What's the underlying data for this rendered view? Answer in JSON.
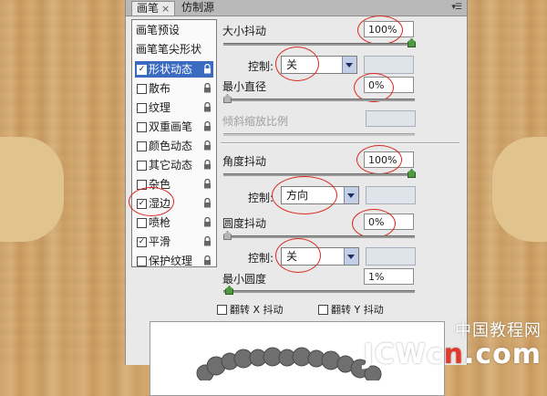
{
  "tabs": [
    {
      "label": "画笔",
      "close": "×"
    },
    {
      "label": "仿制源"
    }
  ],
  "panel_menu_icon": "panel-menu-icon",
  "sidebar": {
    "header_items": [
      "画笔预设",
      "画笔笔尖形状"
    ],
    "items": [
      {
        "label": "形状动态",
        "checked": true,
        "selected": true,
        "checkmark": "✓"
      },
      {
        "label": "散布",
        "checked": false,
        "checkmark": ""
      },
      {
        "label": "纹理",
        "checked": false,
        "checkmark": ""
      },
      {
        "label": "双重画笔",
        "checked": false,
        "checkmark": ""
      },
      {
        "label": "颜色动态",
        "checked": false,
        "checkmark": ""
      },
      {
        "label": "其它动态",
        "checked": false,
        "checkmark": ""
      },
      {
        "label": "杂色",
        "checked": false,
        "checkmark": ""
      },
      {
        "label": "湿边",
        "checked": true,
        "checkmark": "✓"
      },
      {
        "label": "喷枪",
        "checked": false,
        "checkmark": ""
      },
      {
        "label": "平滑",
        "checked": true,
        "checkmark": "✓"
      },
      {
        "label": "保护纹理",
        "checked": false,
        "checkmark": ""
      }
    ]
  },
  "settings": {
    "size_jitter": {
      "label": "大小抖动",
      "value": "100%",
      "level": 1.0
    },
    "size_control": {
      "label": "控制:",
      "value": "关"
    },
    "min_diameter": {
      "label": "最小直径",
      "value": "0%",
      "level": 0.0
    },
    "tilt_scale": {
      "label": "倾斜缩放比例",
      "value": ""
    },
    "angle_jitter": {
      "label": "角度抖动",
      "value": "100%",
      "level": 1.0
    },
    "angle_control": {
      "label": "控制:",
      "value": "方向"
    },
    "roundness_jitter": {
      "label": "圆度抖动",
      "value": "0%",
      "level": 0.0
    },
    "roundness_control": {
      "label": "控制:",
      "value": "关"
    },
    "min_roundness": {
      "label": "最小圆度",
      "value": "1%",
      "level": 0.01
    },
    "flip_x": {
      "label": "翻转 X 抖动",
      "checked": false
    },
    "flip_y": {
      "label": "翻转 Y 抖动",
      "checked": false
    }
  },
  "watermark": {
    "cn": "中国教程网",
    "en_prefix": "JCWc",
    "en_red": "n",
    "en_suffix": ".com"
  },
  "colors": {
    "accent_selected": "#3b6bc1",
    "annotation": "#d8281e",
    "slider_knob": "#4f9a3e"
  }
}
